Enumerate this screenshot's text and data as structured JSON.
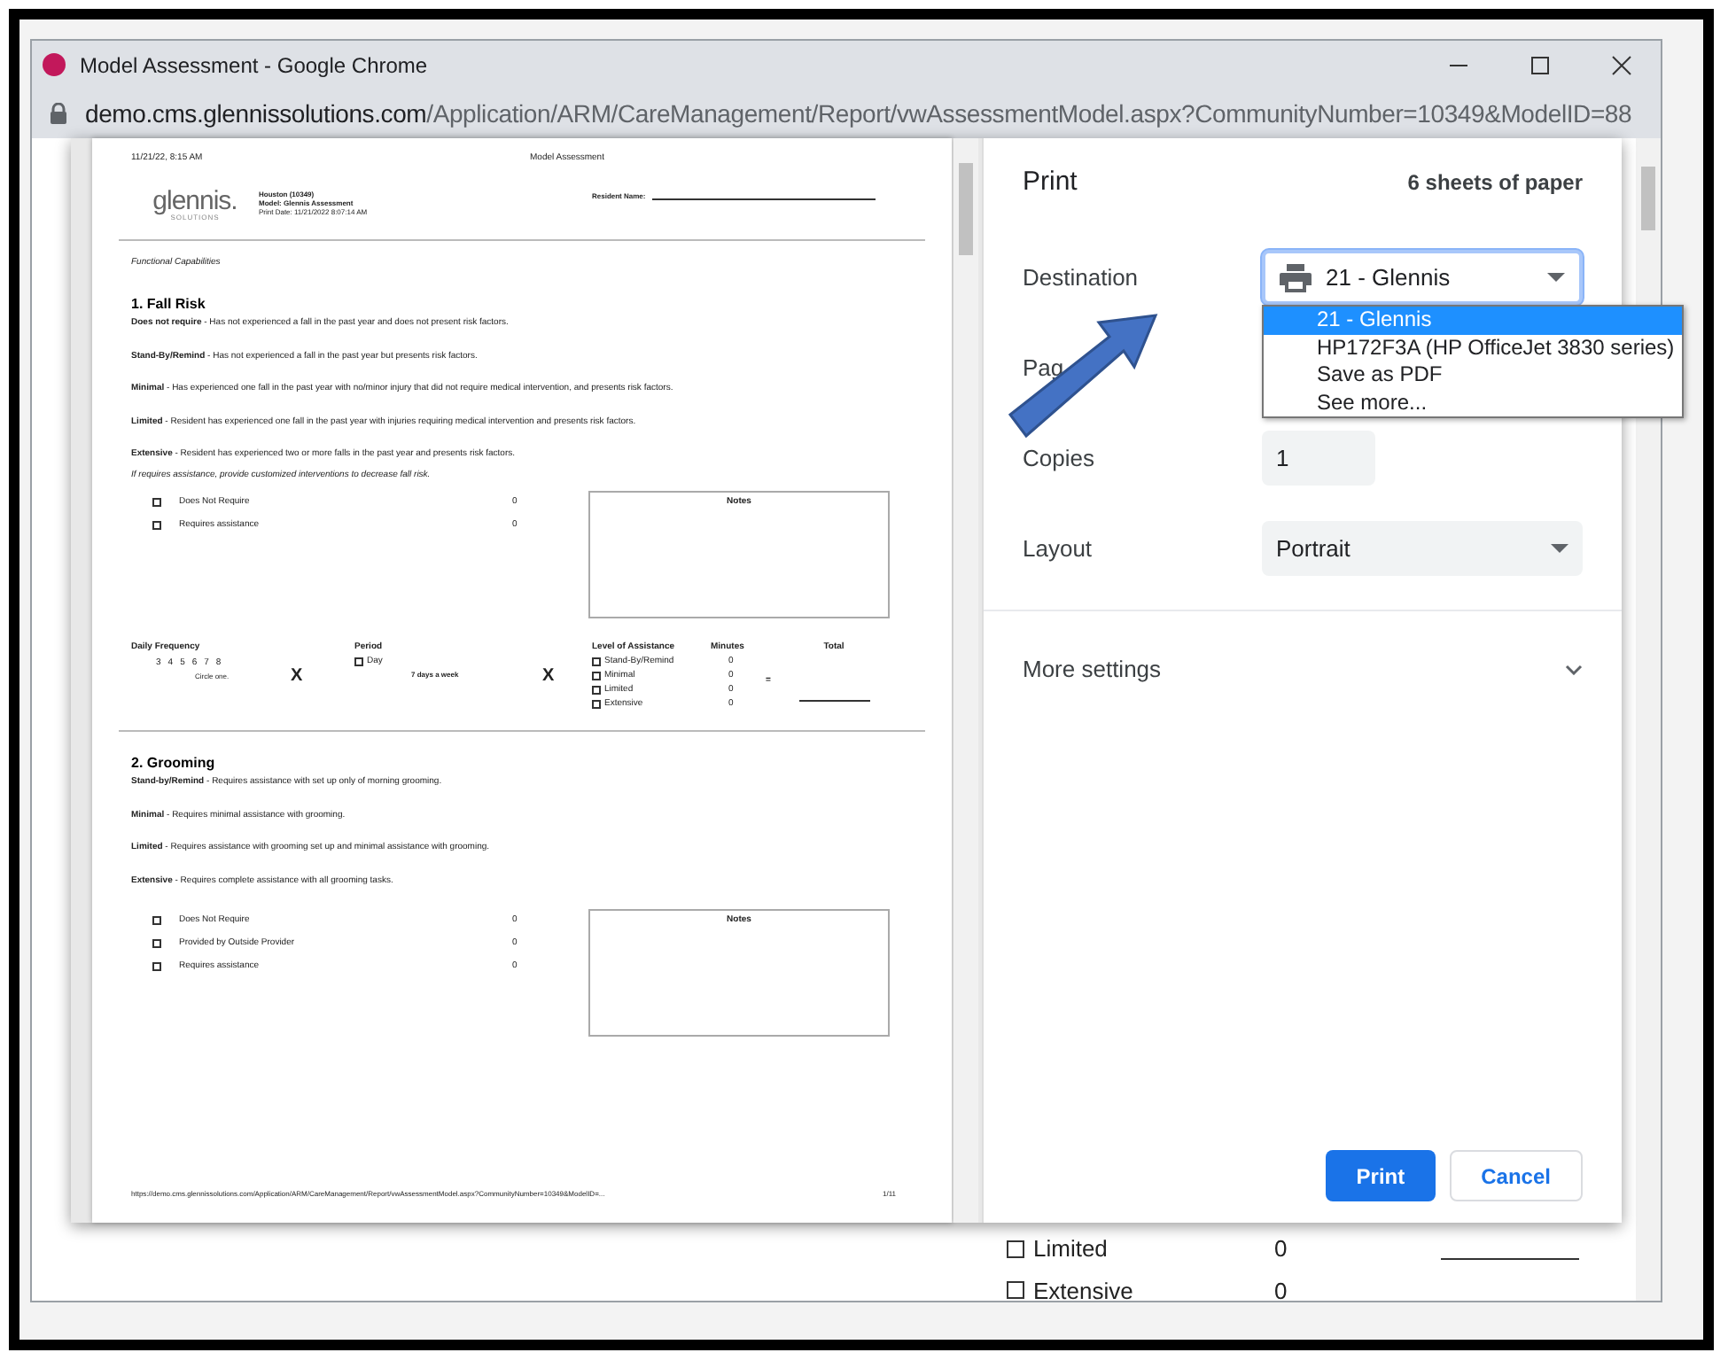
{
  "window": {
    "title": "Model Assessment - Google Chrome",
    "url_host": "demo.cms.glennissolutions.com",
    "url_path": "/Application/ARM/CareManagement/Report/vwAssessmentModel.aspx?CommunityNumber=10349&ModelID=88"
  },
  "preview": {
    "header_date": "11/21/22, 8:15 AM",
    "header_title": "Model Assessment",
    "logo": {
      "name": "glennis.",
      "tagline": "SOLUTIONS"
    },
    "info": [
      {
        "label": "Houston (10349)",
        "bold": true
      },
      {
        "label": "Model:  Glennis Assessment",
        "bold": true
      },
      {
        "label": "Print Date:  11/21/2022 8:07:14 AM",
        "bold": false
      }
    ],
    "resident_label": "Resident Name:",
    "section_label": "Functional Capabilities",
    "sections": [
      {
        "title": "1. Fall Risk",
        "definitions": [
          "**Does not require** - Has not experienced a fall in the past year and does not present risk factors.",
          "**Stand-By/Remind** - Has not experienced a fall in the past year but presents risk factors.",
          "**Minimal** - Has experienced one fall in the past year with no/minor injury that did not require medical intervention, and presents risk factors.",
          "**Limited** - Resident has experienced one fall in the past year with injuries requiring medical intervention and presents risk factors.",
          "**Extensive** - Resident has experienced two or more falls in the past year and presents risk factors."
        ],
        "note": "If requires assistance, provide customized interventions to decrease fall risk.",
        "options": [
          {
            "label": "Does Not Require",
            "score": "0",
            "checked": false
          },
          {
            "label": "Requires assistance",
            "score": "0",
            "checked": false
          }
        ],
        "notes_title": "Notes",
        "frequency": {
          "label": "Daily Frequency",
          "numbers": [
            "3",
            "4",
            "5",
            "6",
            "7",
            "8"
          ],
          "hint": "Circle one.",
          "times": "X",
          "period_label": "Period",
          "period_options": [
            {
              "label": "Day",
              "checked": false
            }
          ],
          "period_value": "7 days a week",
          "times2": "X",
          "level_label": "Level of Assistance",
          "minutes_label": "Minutes",
          "total_label": "Total",
          "equals": "=",
          "levels": [
            {
              "label": "Stand-By/Remind",
              "minutes": "0",
              "checked": false
            },
            {
              "label": "Minimal",
              "minutes": "0",
              "checked": false
            },
            {
              "label": "Limited",
              "minutes": "0",
              "checked": false
            },
            {
              "label": "Extensive",
              "minutes": "0",
              "checked": false
            }
          ]
        }
      },
      {
        "title": "2. Grooming",
        "definitions": [
          "**Stand-by/Remind** - Requires assistance with set up only of morning grooming.",
          "**Minimal** - Requires minimal assistance with grooming.",
          "**Limited** - Requires assistance with grooming set up and minimal assistance with grooming.",
          "**Extensive** - Requires complete assistance with all grooming tasks."
        ],
        "options": [
          {
            "label": "Does Not Require",
            "score": "0",
            "checked": false
          },
          {
            "label": "Provided by Outside Provider",
            "score": "0",
            "checked": false
          },
          {
            "label": "Requires assistance",
            "score": "0",
            "checked": false
          }
        ],
        "notes_title": "Notes"
      }
    ],
    "footer_url": "https://demo.cms.glennissolutions.com/Application/ARM/CareManagement/Report/vwAssessmentModel.aspx?CommunityNumber=10349&ModelID=...",
    "footer_page": "1/11"
  },
  "print": {
    "title": "Print",
    "sheets": "6 sheets of paper",
    "settings": [
      {
        "label": "Destination",
        "kind": "select",
        "value": "21 - Glennis",
        "focused": true
      },
      {
        "label": "Pag",
        "kind": "hidden"
      },
      {
        "label": "Copies",
        "kind": "input",
        "value": "1"
      },
      {
        "label": "Layout",
        "kind": "select",
        "value": "Portrait",
        "focused": false
      }
    ],
    "more_settings": {
      "label": "More settings",
      "expanded": false
    },
    "destination_options": [
      {
        "label": "21 - Glennis",
        "selected": true
      },
      {
        "label": "HP172F3A (HP OfficeJet 3830 series)",
        "selected": false
      },
      {
        "label": "Save as PDF",
        "selected": false
      },
      {
        "label": "See more...",
        "selected": false
      }
    ],
    "buttons": [
      {
        "label": "Print",
        "kind": "primary"
      },
      {
        "label": "Cancel",
        "kind": "secondary"
      }
    ]
  },
  "background_page": {
    "rows": [
      {
        "label": "Limited",
        "minutes": "0",
        "checked": false
      },
      {
        "label": "Extensive",
        "minutes": "0",
        "checked": false
      }
    ]
  }
}
